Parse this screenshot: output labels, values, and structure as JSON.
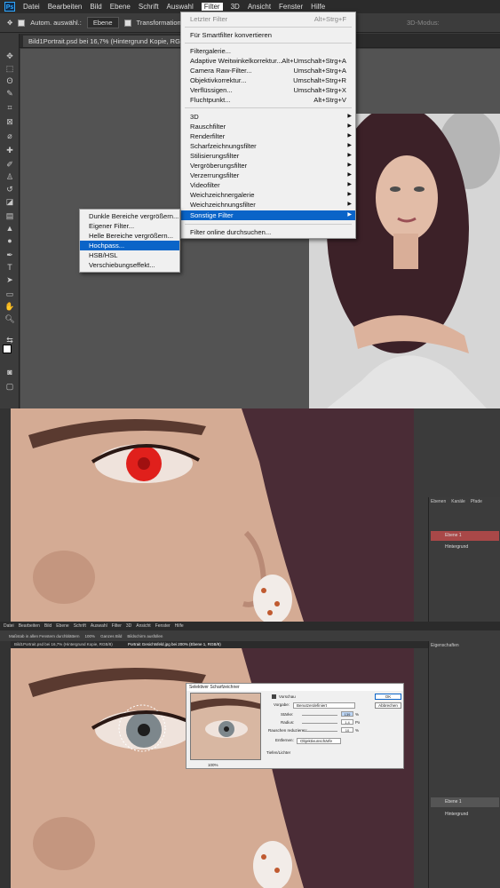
{
  "menubar": {
    "logo": "Ps",
    "items": [
      "Datei",
      "Bearbeiten",
      "Bild",
      "Ebene",
      "Schrift",
      "Auswahl",
      "Filter",
      "3D",
      "Ansicht",
      "Fenster",
      "Hilfe"
    ],
    "active": "Filter"
  },
  "options": {
    "auto_select": "Autom. auswähl.:",
    "layer_select": "Ebene",
    "transform": "Transformationsstrg.",
    "mode_3d": "3D-Modus:"
  },
  "document_tab": "Bild1Portrait.psd bei 16,7% (Hintergrund Kopie, RGB/8)",
  "filter_menu": {
    "group1": [
      {
        "label": "Letzter Filter",
        "shortcut": "Alt+Strg+F",
        "disabled": true
      }
    ],
    "group2": [
      {
        "label": "Für Smartfilter konvertieren",
        "shortcut": ""
      }
    ],
    "group3": [
      {
        "label": "Filtergalerie...",
        "shortcut": ""
      },
      {
        "label": "Adaptive Weitwinkelkorrektur...",
        "shortcut": "Alt+Umschalt+Strg+A"
      },
      {
        "label": "Camera Raw-Filter...",
        "shortcut": "Umschalt+Strg+A"
      },
      {
        "label": "Objektivkorrektur...",
        "shortcut": "Umschalt+Strg+R"
      },
      {
        "label": "Verflüssigen...",
        "shortcut": "Umschalt+Strg+X"
      },
      {
        "label": "Fluchtpunkt...",
        "shortcut": "Alt+Strg+V"
      }
    ],
    "group4": [
      {
        "label": "3D"
      },
      {
        "label": "Rauschfilter"
      },
      {
        "label": "Renderfilter"
      },
      {
        "label": "Scharfzeichnungsfilter"
      },
      {
        "label": "Stilisierungsfilter"
      },
      {
        "label": "Vergröberungsfilter"
      },
      {
        "label": "Verzerrungsfilter"
      },
      {
        "label": "Videofilter"
      },
      {
        "label": "Weichzeichnergalerie"
      },
      {
        "label": "Weichzeichnungsfilter"
      },
      {
        "label": "Sonstige Filter"
      }
    ],
    "highlighted": "Sonstige Filter",
    "group5": [
      {
        "label": "Filter online durchsuchen..."
      }
    ],
    "arrow": "▶"
  },
  "submenu": {
    "items": [
      "Dunkle Bereiche vergrößern...",
      "Eigener Filter...",
      "Helle Bereiche vergrößern...",
      "Hochpass...",
      "HSB/HSL",
      "Verschiebungseffekt..."
    ],
    "highlighted": "Hochpass..."
  },
  "mid_layers": {
    "tabs": [
      "Ebenen",
      "Kanäle",
      "Pfade"
    ],
    "items": [
      "Ebene 1",
      "Hintergrund"
    ]
  },
  "bottom": {
    "menubar": [
      "Datei",
      "Bearbeiten",
      "Bild",
      "Ebene",
      "Schrift",
      "Auswahl",
      "Filter",
      "3D",
      "Ansicht",
      "Fenster",
      "Hilfe"
    ],
    "options": [
      "Maßstab in allen Fenstern durchblättern",
      "100%",
      "Ganzes Bild",
      "Bildschirm ausfüllen"
    ],
    "tabs": [
      "Bild1Portrait.psd bei 16,7% (Hintergrund Kopie, RGB/8)",
      "Portrait Gesichtsfeld.jpg bei 200% (Ebene 1, RGB/8)"
    ],
    "panel_title": "Eigenschaften",
    "layers": [
      "Ebene 1",
      "Hintergrund"
    ]
  },
  "dialog": {
    "title": "Selektiver Scharfzeichner",
    "ok": "OK",
    "cancel": "Abbrechen",
    "preview_label": "Vorschau",
    "preset_label": "Vorgabe:",
    "preset_value": "Benutzerdefiniert",
    "zoom": "100%",
    "rows": [
      {
        "label": "Stärke:",
        "value": "139",
        "unit": "%"
      },
      {
        "label": "Radius:",
        "value": "1,4",
        "unit": "Px"
      },
      {
        "label": "Rauschen reduzieren:",
        "value": "10",
        "unit": "%"
      }
    ],
    "remove_label": "Entfernen:",
    "remove_value": "Objektivunschärfe",
    "section": "Tiefen/Lichter"
  }
}
